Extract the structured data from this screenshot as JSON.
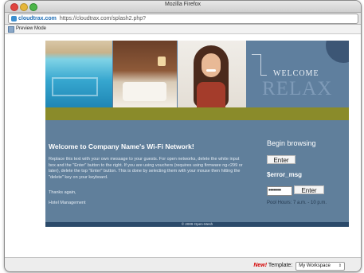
{
  "window": {
    "title": "Mozilla Firefox"
  },
  "address_bar": {
    "host": "cloudtrax.com",
    "url": "https://cloudtrax.com/splash2.php?"
  },
  "toolbar": {
    "preview_mode": "Preview Mode"
  },
  "hero": {
    "welcome": "WELCOME",
    "relax": "RELAX"
  },
  "message": {
    "title": "Welcome to Company Name's Wi-Fi Network!",
    "body": "Replace this text with your own message to your guests. For open networks, delete the white input box and the \"Enter\" button to the right. If you are using vouchers (requires using firmware ng-r299 or later), delete the top \"Enter\" button. This is done by selecting them with your mouse then hitting the \"delete\" key on your keyboard.",
    "thanks": "Thanks again,",
    "signature": "Hotel Management"
  },
  "login": {
    "heading": "Begin browsing",
    "enter_top": "Enter",
    "error_msg": "$error_msg",
    "password_value": "••••••••",
    "enter_bottom": "Enter",
    "pool_hours": "Pool Hours: 7 a.m. - 10 p.m."
  },
  "footer": {
    "text": "© 2009 Open-Mesh"
  },
  "statusbar": {
    "new_label": "New!",
    "template_label": "Template:",
    "template_value": "My Workspace",
    "template_arrow": "⇕"
  }
}
